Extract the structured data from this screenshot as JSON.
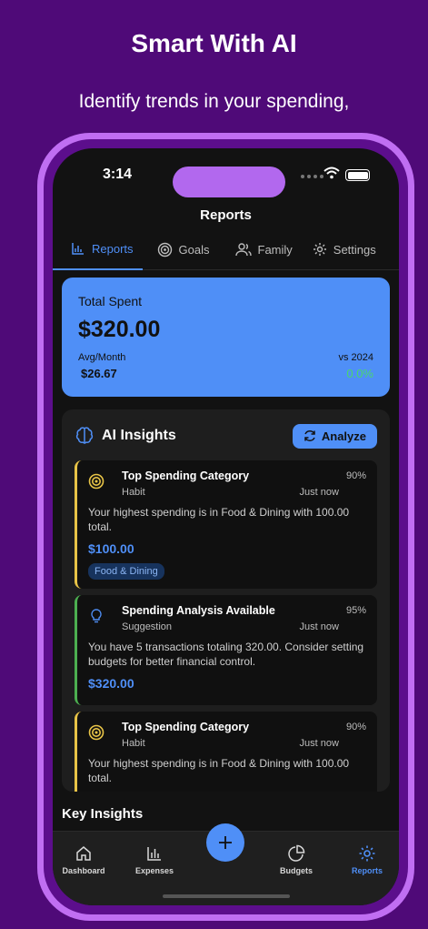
{
  "hero": {
    "title": "Smart With AI",
    "subtitle": "Identify trends in your spending,"
  },
  "status_bar": {
    "time": "3:14"
  },
  "header": {
    "title": "Reports"
  },
  "tabs": [
    {
      "label": "Reports",
      "icon": "bar-chart-icon",
      "active": true
    },
    {
      "label": "Goals",
      "icon": "target-icon",
      "active": false
    },
    {
      "label": "Family",
      "icon": "users-icon",
      "active": false
    },
    {
      "label": "Settings",
      "icon": "gear-icon",
      "active": false
    }
  ],
  "summary": {
    "label": "Total Spent",
    "amount": "$320.00",
    "avg_label": "Avg/Month",
    "avg_value": "$26.67",
    "compare_label": "vs 2024",
    "compare_value": "0.0%"
  },
  "ai_insights": {
    "title": "AI Insights",
    "analyze_label": "Analyze",
    "items": [
      {
        "title": "Top Spending Category",
        "type": "Habit",
        "time": "Just now",
        "confidence": "90%",
        "description": "Your highest spending is in Food & Dining with 100.00 total.",
        "amount": "$100.00",
        "tag": "Food & Dining",
        "icon": "target-icon",
        "accent": "#e8c447"
      },
      {
        "title": "Spending Analysis Available",
        "type": "Suggestion",
        "time": "Just now",
        "confidence": "95%",
        "description": "You have 5 transactions totaling 320.00. Consider setting budgets for better financial control.",
        "amount": "$320.00",
        "icon": "lightbulb-icon",
        "accent": "#4caf50"
      },
      {
        "title": "Top Spending Category",
        "type": "Habit",
        "time": "Just now",
        "confidence": "90%",
        "description": "Your highest spending is in Food & Dining with 100.00 total.",
        "icon": "target-icon",
        "accent": "#e8c447"
      }
    ]
  },
  "key_insights": {
    "title": "Key Insights"
  },
  "bottom_nav": [
    {
      "label": "Dashboard",
      "icon": "home-icon",
      "active": false
    },
    {
      "label": "Expenses",
      "icon": "bar-chart-icon",
      "active": false
    },
    {
      "label": "Budgets",
      "icon": "pie-chart-icon",
      "active": false
    },
    {
      "label": "Reports",
      "icon": "gear-icon",
      "active": true
    }
  ],
  "colors": {
    "accent": "#4f8ff7",
    "background": "#4f0a78",
    "positive": "#4ad66d"
  }
}
